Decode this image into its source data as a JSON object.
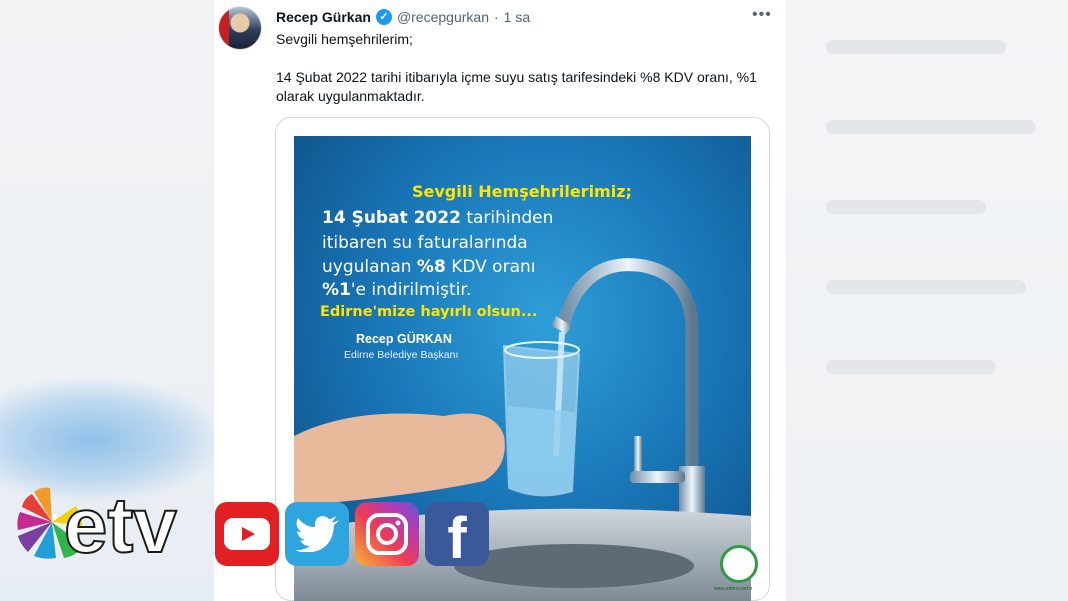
{
  "tweet": {
    "author_name": "Recep Gürkan",
    "handle": "@recepgurkan",
    "separator": "·",
    "time": "1 sa",
    "more_label": "•••",
    "verified_mark": "✓",
    "text_line1": "Sevgili hemşehrilerim;",
    "text_line2": "14 Şubat 2022 tarihi itibarıyla içme suyu satış tarifesindeki %8 KDV oranı, %1 olarak uygulanmaktadır."
  },
  "poster": {
    "greeting": "Sevgili Hemşehrilerimiz;",
    "line1_bold": "14 Şubat 2022",
    "line1_rest": " tarihinden",
    "line2": "itibaren su faturalarında",
    "line3_pre": "uygulanan ",
    "line3_bold": "%8",
    "line3_post": " KDV oranı",
    "line4_bold": "%1",
    "line4_rest": "'e indirilmiştir.",
    "wish": "Edirne'mize hayırlı olsun...",
    "signer": "Recep GÜRKAN",
    "signer_title": "Edirne Belediye Başkanı",
    "footer_url": "www.edirne.bel.tr"
  },
  "overlay": {
    "brand": "etv",
    "icons": [
      "youtube-icon",
      "twitter-icon",
      "instagram-icon",
      "facebook-icon"
    ],
    "facebook_glyph": "f"
  },
  "colors": {
    "yellow_text": "#ffe600",
    "twitter_blue": "#1d9bf0",
    "youtube_red": "#e21f23",
    "facebook_blue": "#39599b"
  }
}
